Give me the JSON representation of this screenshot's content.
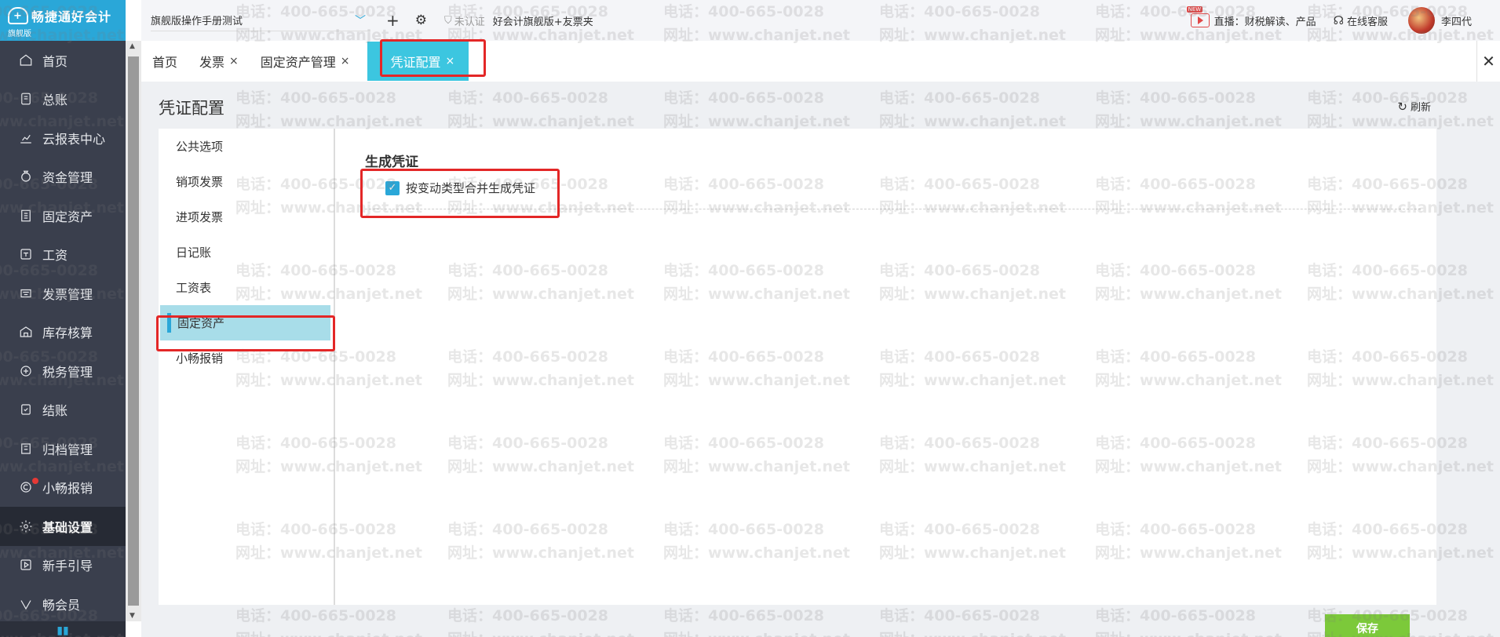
{
  "app": {
    "brand": "畅捷通好会计",
    "edition": "旗舰版"
  },
  "sidebar": {
    "items": [
      {
        "label": "首页",
        "icon": "home-icon"
      },
      {
        "label": "总账",
        "icon": "ledger-icon"
      },
      {
        "label": "云报表中心",
        "icon": "chart-icon"
      },
      {
        "label": "资金管理",
        "icon": "money-bag-icon"
      },
      {
        "label": "固定资产",
        "icon": "building-icon"
      },
      {
        "label": "工资",
        "icon": "salary-icon"
      },
      {
        "label": "发票管理",
        "icon": "invoice-icon"
      },
      {
        "label": "库存核算",
        "icon": "warehouse-icon"
      },
      {
        "label": "税务管理",
        "icon": "tax-icon"
      },
      {
        "label": "结账",
        "icon": "checkout-icon"
      },
      {
        "label": "归档管理",
        "icon": "archive-icon"
      },
      {
        "label": "小畅报销",
        "icon": "reimburse-icon"
      },
      {
        "label": "基础设置",
        "icon": "gear-icon"
      },
      {
        "label": "新手引导",
        "icon": "guide-icon"
      },
      {
        "label": "畅会员",
        "icon": "vip-icon"
      }
    ],
    "active_index": 12
  },
  "topbar": {
    "company": "旗舰版操作手册测试",
    "certification": "未认证",
    "product": "好会计旗舰版+友票夹",
    "live_badge": "NEW",
    "live_text": "直播：财税解读、产品",
    "service": "在线客服",
    "user_name": "李四代"
  },
  "tabs": [
    {
      "label": "首页",
      "closable": false
    },
    {
      "label": "发票",
      "closable": true
    },
    {
      "label": "固定资产管理",
      "closable": true
    },
    {
      "label": "凭证配置",
      "closable": true,
      "active": true
    }
  ],
  "tab_close_symbol": "×",
  "page": {
    "title": "凭证配置",
    "refresh_label": "刷新"
  },
  "settings_menu": {
    "items": [
      "公共选项",
      "销项发票",
      "进项发票",
      "日记账",
      "工资表",
      "固定资产",
      "小畅报销"
    ],
    "active_index": 5
  },
  "section": {
    "title": "生成凭证",
    "option_label": "按变动类型合并生成凭证",
    "option_checked": true
  },
  "save_label": "保存",
  "watermark": {
    "phone": "电话：400-665-0028",
    "site": "网址：www.chanjet.net"
  },
  "colors": {
    "brand": "#2aa7d8",
    "active_tab": "#3cc6e0",
    "sidebar_bg": "#3a3f4d",
    "highlight_red": "#e32727",
    "save_green": "#7cc93a"
  }
}
